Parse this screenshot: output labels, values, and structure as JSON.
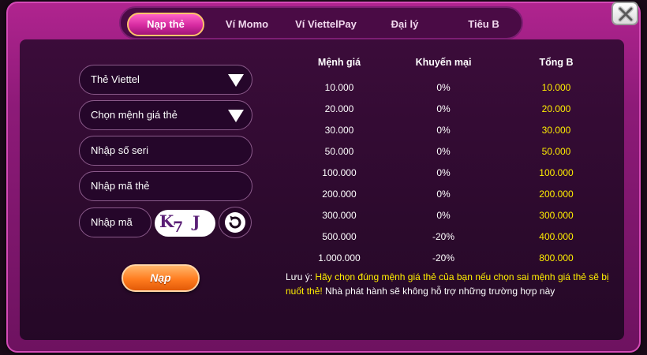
{
  "tabs": [
    {
      "label": "Nạp thẻ",
      "active": true
    },
    {
      "label": "Ví Momo",
      "active": false
    },
    {
      "label": "Ví ViettelPay",
      "active": false
    },
    {
      "label": "Đại lý",
      "active": false
    },
    {
      "label": "Tiêu B",
      "active": false
    }
  ],
  "form": {
    "carrier_select": "Thẻ Viettel",
    "amount_select": "Chọn mệnh giá thẻ",
    "serial_placeholder": "Nhập số seri",
    "code_placeholder": "Nhập mã thẻ",
    "captcha_placeholder": "Nhập mã",
    "captcha_text": "K7 J",
    "submit_label": "Nạp"
  },
  "table": {
    "headers": [
      "Mệnh giá",
      "Khuyến mại",
      "Tổng B"
    ],
    "rows": [
      {
        "value": "10.000",
        "bonus": "0%",
        "total": "10.000"
      },
      {
        "value": "20.000",
        "bonus": "0%",
        "total": "20.000"
      },
      {
        "value": "30.000",
        "bonus": "0%",
        "total": "30.000"
      },
      {
        "value": "50.000",
        "bonus": "0%",
        "total": "50.000"
      },
      {
        "value": "100.000",
        "bonus": "0%",
        "total": "100.000"
      },
      {
        "value": "200.000",
        "bonus": "0%",
        "total": "200.000"
      },
      {
        "value": "300.000",
        "bonus": "0%",
        "total": "300.000"
      },
      {
        "value": "500.000",
        "bonus": "-20%",
        "total": "400.000"
      },
      {
        "value": "1.000.000",
        "bonus": "-20%",
        "total": "800.000"
      }
    ]
  },
  "note": {
    "prefix": "Lưu ý: ",
    "highlight": "Hãy chọn đúng mệnh giá thẻ của bạn nếu chọn sai mệnh giá thẻ sẽ bị nuốt thẻ!",
    "rest": " Nhà phát hành sẽ không hỗ trợ những trường hợp này"
  },
  "colors": {
    "frame": "#9a1e82",
    "panel": "#2f0a30",
    "bonus_total": "#ffee00",
    "highlight_text": "#ffee00",
    "submit_button": "#ff7c1f",
    "active_tab": "#e23aa8"
  },
  "icons": {
    "close": "close-icon",
    "carrier_caret": "triangle-down-icon",
    "amount_caret": "triangle-down-icon",
    "refresh": "refresh-icon"
  }
}
